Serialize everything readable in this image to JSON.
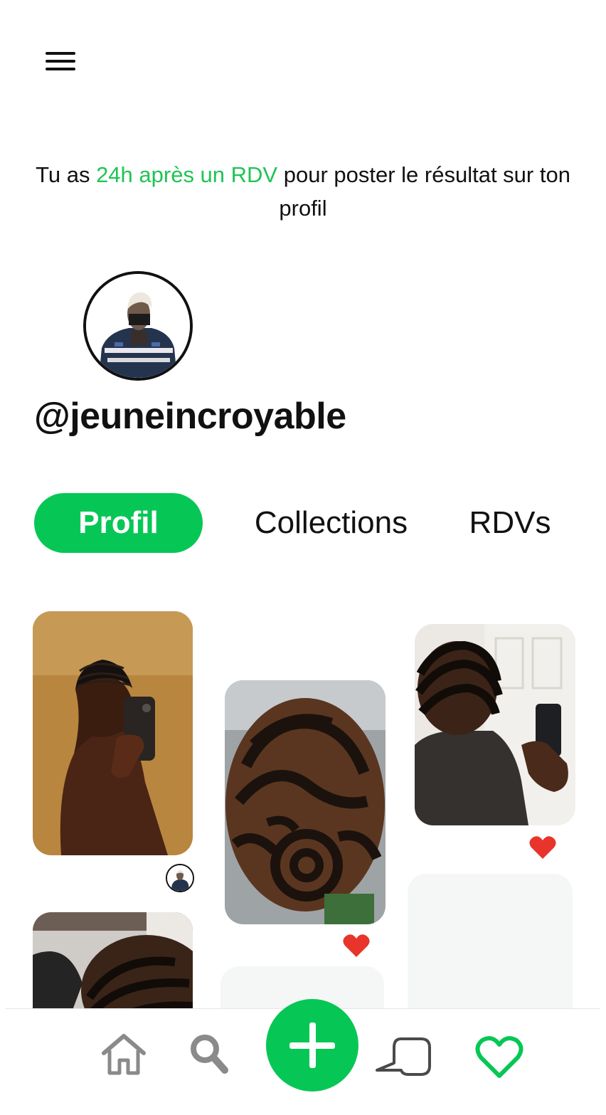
{
  "header": {
    "menu_icon": "hamburger-menu-icon"
  },
  "notice": {
    "prefix": "Tu as ",
    "highlight": "24h après un RDV",
    "suffix": " pour poster le résultat sur ton profil"
  },
  "profile": {
    "username": "@jeuneincroyable",
    "avatar": "profile-avatar"
  },
  "tabs": [
    {
      "label": "Profil",
      "active": true
    },
    {
      "label": "Collections",
      "active": false
    },
    {
      "label": "RDVs",
      "active": false
    }
  ],
  "posts": [
    {
      "description": "man with cornrows taking mirror selfie",
      "liked": false
    },
    {
      "description": "top view of swirl braids hairstyle",
      "liked": true
    },
    {
      "description": "man with cornrows in front of door mirror",
      "liked": true
    },
    {
      "description": "cornrows side view in salon",
      "liked": false
    }
  ],
  "bottom_nav": [
    {
      "icon": "home-icon"
    },
    {
      "icon": "search-icon"
    },
    {
      "icon": "add-icon"
    },
    {
      "icon": "chat-icon"
    },
    {
      "icon": "heart-icon",
      "active": true
    }
  ],
  "colors": {
    "accent": "#06c755",
    "heart": "#e8342a",
    "text": "#111111"
  }
}
